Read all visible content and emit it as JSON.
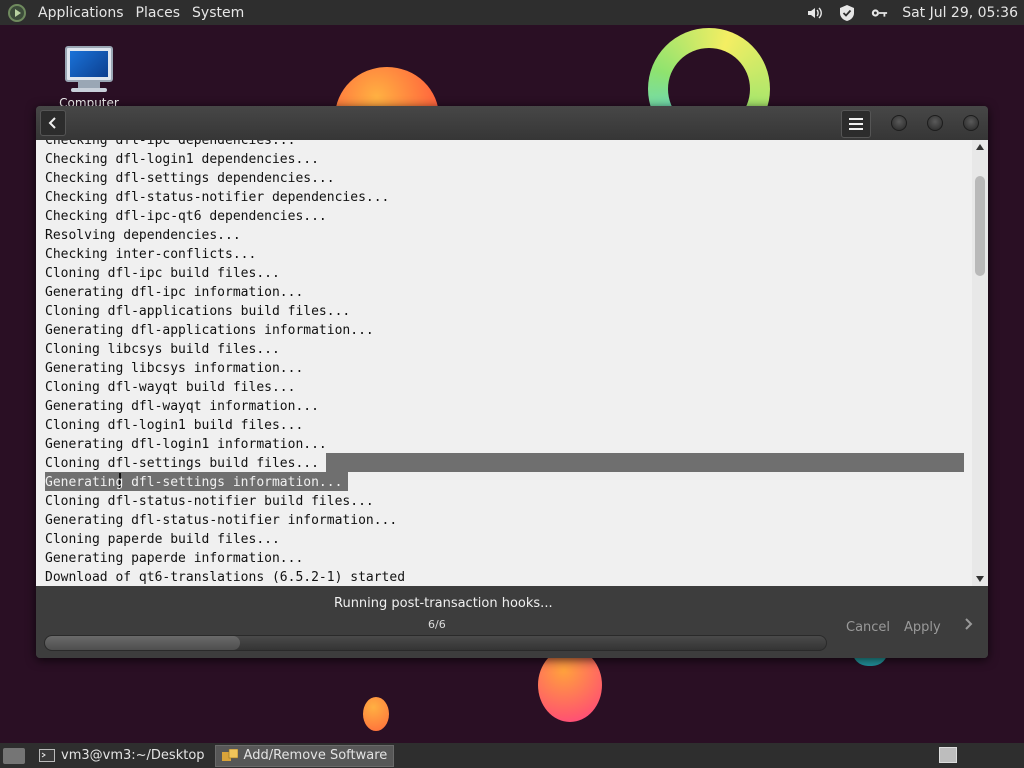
{
  "top_panel": {
    "menus": [
      "Applications",
      "Places",
      "System"
    ],
    "clock": "Sat Jul 29, 05:36",
    "tray_icons": [
      "volume-icon",
      "shield-icon",
      "key-icon"
    ]
  },
  "desktop": {
    "icons": [
      {
        "label": "Computer",
        "icon": "computer-icon"
      }
    ]
  },
  "window": {
    "log_lines": [
      "Checking dfl-ipc dependencies...",
      "Checking dfl-login1 dependencies...",
      "Checking dfl-settings dependencies...",
      "Checking dfl-status-notifier dependencies...",
      "Checking dfl-ipc-qt6 dependencies...",
      "Resolving dependencies...",
      "Checking inter-conflicts...",
      "Cloning dfl-ipc build files...",
      "Generating dfl-ipc information...",
      "Cloning dfl-applications build files...",
      "Generating dfl-applications information...",
      "Cloning libcsys build files...",
      "Generating libcsys information...",
      "Cloning dfl-wayqt build files...",
      "Generating dfl-wayqt information...",
      "Cloning dfl-login1 build files...",
      "Generating dfl-login1 information...",
      "Cloning dfl-settings build files...",
      "Generating dfl-settings information...",
      "Cloning dfl-status-notifier build files...",
      "Generating dfl-status-notifier information...",
      "Cloning paperde build files...",
      "Generating paperde information...",
      "Download of qt6-translations (6.5.2-1) started"
    ],
    "selected_lines": [
      17,
      18
    ],
    "status": "Running post-transaction hooks...",
    "progress_text": "6/6",
    "progress_fraction": 0.25,
    "cancel_label": "Cancel",
    "apply_label": "Apply"
  },
  "taskbar": {
    "tasks": [
      {
        "label": "vm3@vm3:~/Desktop",
        "icon": "terminal-icon",
        "active": false
      },
      {
        "label": "Add/Remove Software",
        "icon": "package-icon",
        "active": true
      }
    ]
  },
  "colors": {
    "desktop_bg": "#2a0f24",
    "panel_bg": "#2e2e2e",
    "selection": "#6f6f6f"
  }
}
